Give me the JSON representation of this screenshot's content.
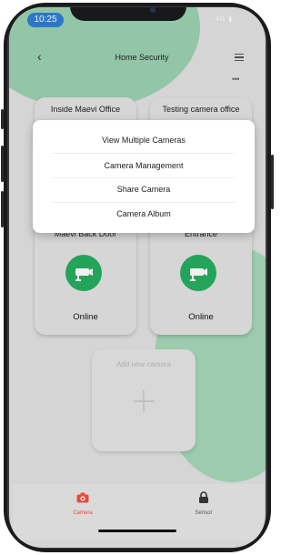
{
  "status_bar": {
    "time": "10:25",
    "indicators": "⋯ 4G ▮"
  },
  "header": {
    "title": "Home Security",
    "back_icon": "chevron-left-icon",
    "menu_icon": "hamburger-icon",
    "more_icon": "more-dots-icon"
  },
  "cameras": [
    {
      "name": "Inside Maevi Office"
    },
    {
      "name": "Testing camera office"
    },
    {
      "name": "Maevi Back Door",
      "status": "Online",
      "icon": "camera-icon"
    },
    {
      "name": "Entrance",
      "status": "Online",
      "icon": "camera-icon"
    }
  ],
  "add_camera": {
    "label": "Add new camera",
    "icon": "plus-icon"
  },
  "dropdown": {
    "items": [
      {
        "label": "View Multiple Cameras"
      },
      {
        "label": "Camera Management"
      },
      {
        "label": "Share Camera"
      },
      {
        "label": "Camera Album"
      }
    ]
  },
  "tabbar": {
    "tabs": [
      {
        "label": "Camera",
        "icon": "camera-icon",
        "active": true,
        "color": "#e8493c"
      },
      {
        "label": "Sensor",
        "icon": "lock-icon",
        "active": false,
        "color": "#333333"
      }
    ]
  },
  "colors": {
    "accent_green": "#27ae60",
    "status_blue": "#2f7fd6",
    "active_tab": "#e8493c"
  }
}
